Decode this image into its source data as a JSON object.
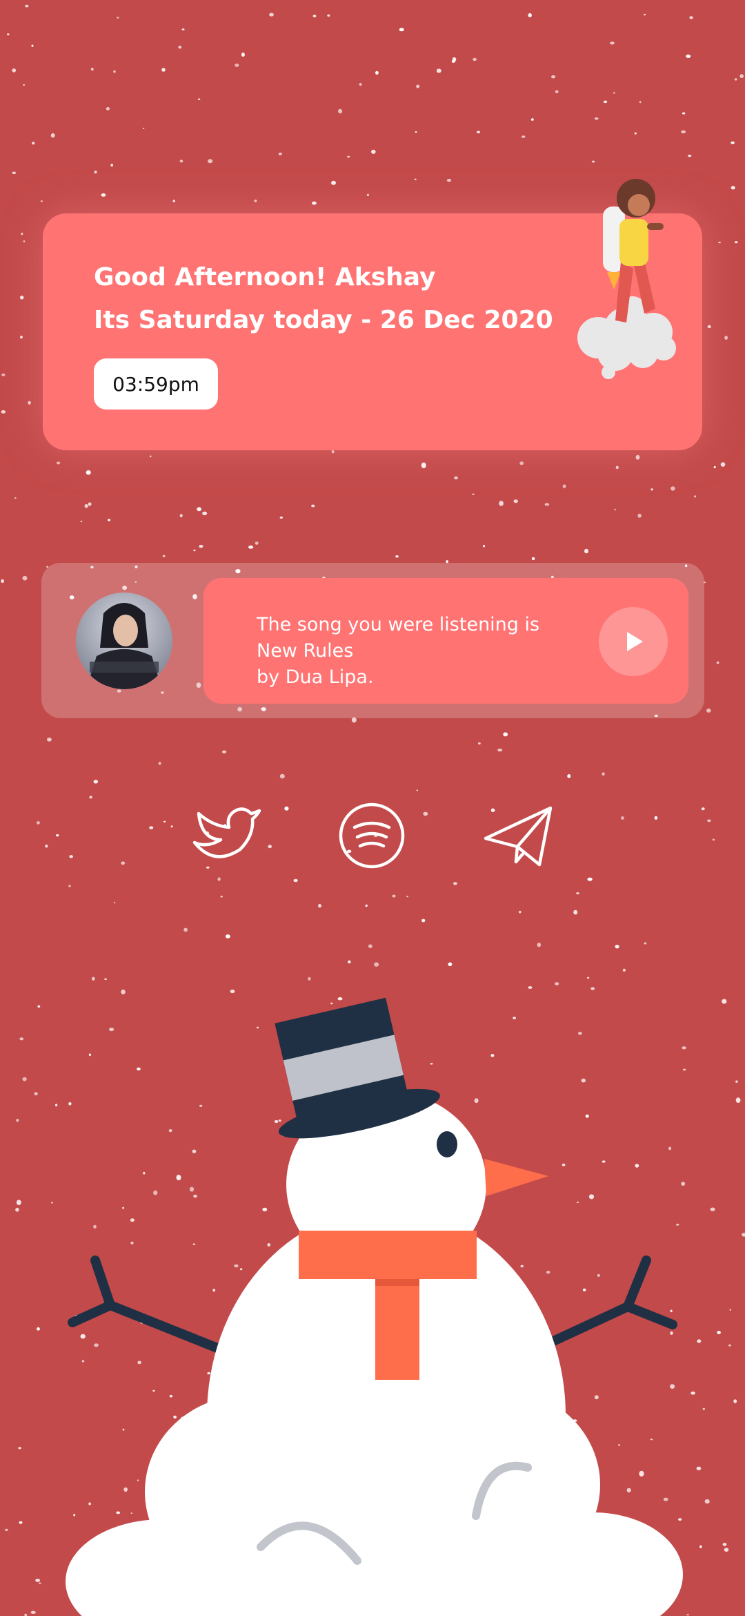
{
  "greeting": {
    "line1": "Good Afternoon! Akshay",
    "line2": "Its Saturday today - 26 Dec 2020",
    "time": "03:59pm"
  },
  "music": {
    "line1": "The song you were listening is",
    "line2": "New Rules",
    "line3": "by Dua Lipa.",
    "play_icon": "play-icon"
  },
  "social": [
    {
      "icon": "twitter-icon"
    },
    {
      "icon": "spotify-icon"
    },
    {
      "icon": "telegram-icon"
    }
  ],
  "colors": {
    "background": "#c34a4a",
    "card": "#ff7373",
    "snowman_hat": "#1f3044",
    "snowman_scarf": "#ff6e4a"
  }
}
